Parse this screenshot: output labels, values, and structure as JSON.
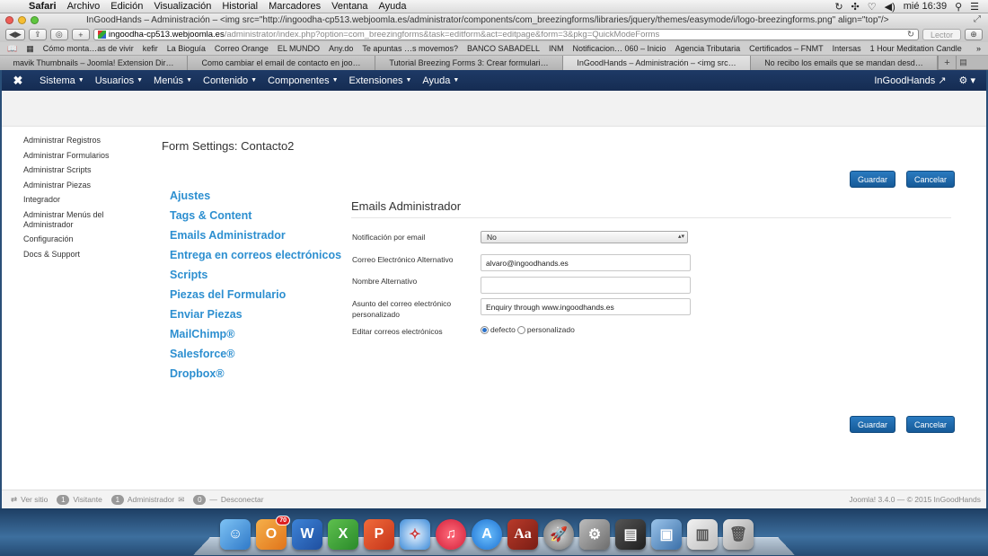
{
  "mac_menubar": {
    "items": [
      "Safari",
      "Archivo",
      "Edición",
      "Visualización",
      "Historial",
      "Marcadores",
      "Ventana",
      "Ayuda"
    ],
    "clock": "mié 16:39"
  },
  "window": {
    "title": "InGoodHands – Administración – <img src=\"http://ingoodha-cp513.webjoomla.es/administrator/components/com_breezingforms/libraries/jquery/themes/easymode/i/logo-breezingforms.png\" align=\"top\"/>"
  },
  "toolbar": {
    "url_host": "ingoodha-cp513.webjoomla.es",
    "url_path": "/administrator/index.php?option=com_breezingforms&task=editform&act=editpage&form=3&pkg=QuickModeForms",
    "reader_label": "Lector"
  },
  "bookmarks": [
    "Cómo monta…as de vivir",
    "kefir",
    "La Bioguía",
    "Correo Orange",
    "EL MUNDO",
    "Any.do",
    "Te apuntas …s movemos?",
    "BANCO SABADELL",
    "INM",
    "Notificacion… 060 – Inicio",
    "Agencia Tributaria",
    "Certificados – FNMT",
    "Intersas",
    "1 Hour Meditation Candle"
  ],
  "tabs": [
    {
      "label": "mavik Thumbnails – Joomla! Extension Dir…"
    },
    {
      "label": "Como cambiar el email de contacto en joo…"
    },
    {
      "label": "Tutorial Breezing Forms 3: Crear formulari…"
    },
    {
      "label": "InGoodHands – Administración – <img src…"
    },
    {
      "label": "No recibo los emails que se mandan desd…"
    }
  ],
  "joomla_nav": {
    "menus": [
      "Sistema",
      "Usuarios",
      "Menús",
      "Contenido",
      "Componentes",
      "Extensiones",
      "Ayuda"
    ],
    "site_link": "InGoodHands"
  },
  "sidebar": [
    "Administrar Registros",
    "Administrar Formularios",
    "Administrar Scripts",
    "Administrar Piezas",
    "Integrador",
    "Administrar Menús del Administrador",
    "Configuración",
    "Docs & Support"
  ],
  "form": {
    "title": "Form Settings: Contacto2",
    "save_label": "Guardar",
    "cancel_label": "Cancelar"
  },
  "left_menu": [
    "Ajustes",
    "Tags & Content",
    "Emails Administrador",
    "Entrega en correos electrónicos",
    "Scripts",
    "Piezas del Formulario",
    "Enviar Piezas",
    "MailChimp®",
    "Salesforce®",
    "Dropbox®"
  ],
  "section": {
    "title": "Emails Administrador",
    "notif_label": "Notificación por email",
    "notif_value": "No",
    "alt_email_label": "Correo Electrónico Alternativo",
    "alt_email_value": "alvaro@ingoodhands.es",
    "alt_name_label": "Nombre Alternativo",
    "alt_name_value": "",
    "subject_label": "Asunto del correo electrónico personalizado",
    "subject_value": "Enquiry through www.ingoodhands.es",
    "edit_label": "Editar correos electrónicos",
    "radio_default": "defecto",
    "radio_custom": "personalizado"
  },
  "status": {
    "view_site": "Ver sitio",
    "visitors_count": "1",
    "visitors_label": "Visitante",
    "admins_count": "1",
    "admins_label": "Administrador",
    "messages_count": "0",
    "logout": "Desconectar",
    "footer": "Joomla! 3.4.0 — © 2015 InGoodHands"
  },
  "dock": {
    "mail_badge": "70"
  }
}
